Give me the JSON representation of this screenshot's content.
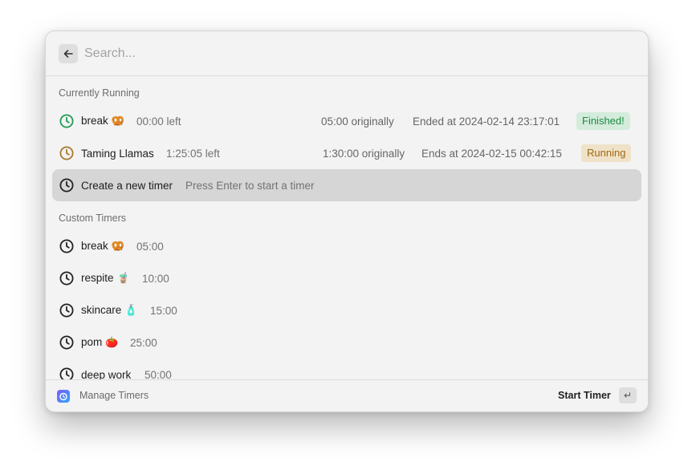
{
  "search": {
    "placeholder": "Search..."
  },
  "sections": {
    "running": "Currently Running",
    "custom": "Custom Timers"
  },
  "running": [
    {
      "title": "break",
      "emoji": "🥨",
      "remaining": "00:00 left",
      "original": "05:00 originally",
      "ends": "Ended at 2024-02-14 23:17:01",
      "tag": "Finished!",
      "icon_color": "#1f9a54"
    },
    {
      "title": "Taming Llamas",
      "emoji": "",
      "remaining": "1:25:05 left",
      "original": "1:30:00 originally",
      "ends": "Ends at 2024-02-15 00:42:15",
      "tag": "Running",
      "icon_color": "#a8782a"
    }
  ],
  "create": {
    "title": "Create a new timer",
    "hint": "Press Enter to start a timer"
  },
  "custom": [
    {
      "title": "break",
      "emoji": "🥨",
      "duration": "05:00"
    },
    {
      "title": "respite",
      "emoji": "🧋",
      "duration": "10:00"
    },
    {
      "title": "skincare",
      "emoji": "🧴",
      "duration": "15:00"
    },
    {
      "title": "pom",
      "emoji": "🍅",
      "duration": "25:00"
    },
    {
      "title": "deep work",
      "emoji": "",
      "duration": "50:00"
    }
  ],
  "footer": {
    "manage": "Manage Timers",
    "action": "Start Timer",
    "key": "↵"
  },
  "colors": {
    "finished": "#1f8a44",
    "running": "#a06a12",
    "selected_bg": "#d6d6d6"
  }
}
